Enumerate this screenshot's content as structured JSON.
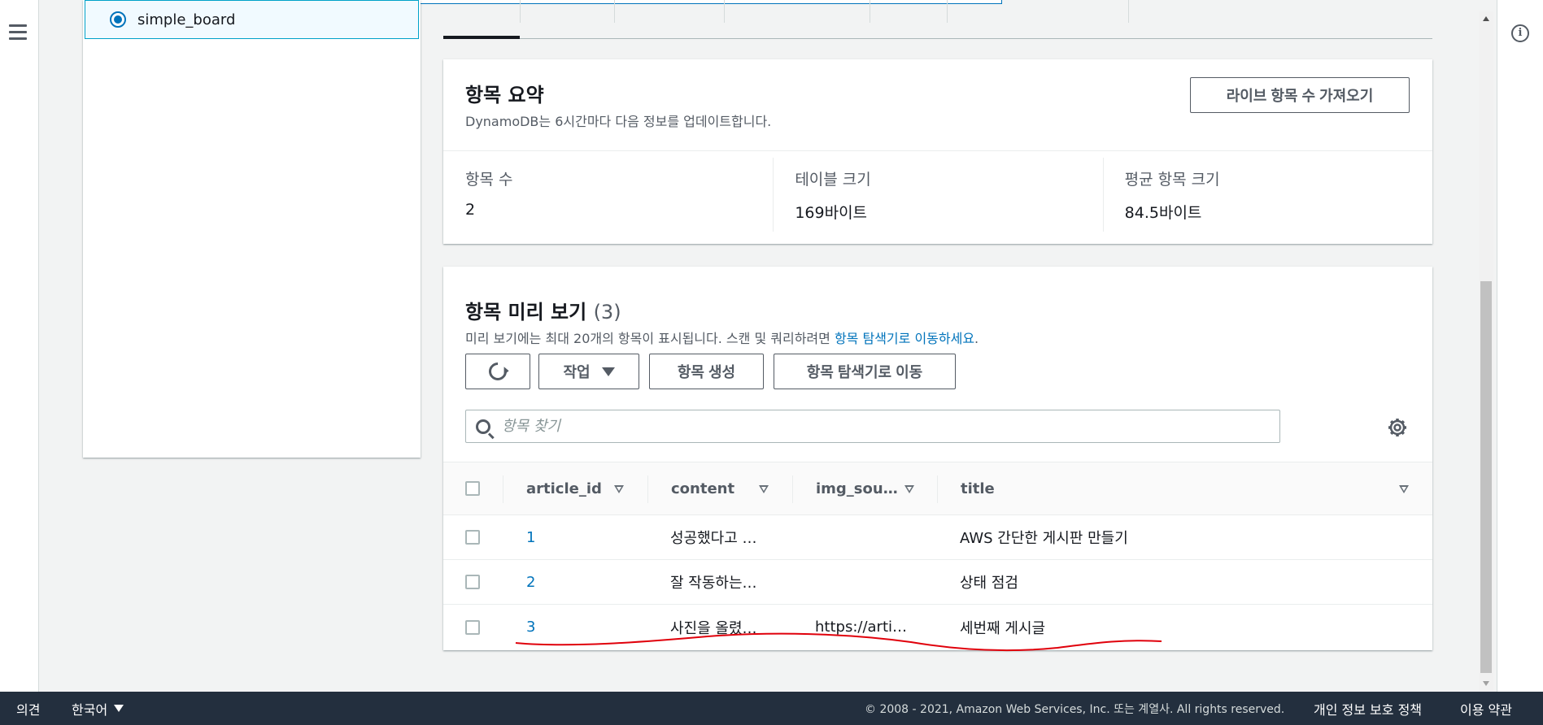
{
  "left_panel": {
    "selected_table": "simple_board"
  },
  "summary": {
    "title": "항목 요약",
    "description": "DynamoDB는 6시간마다 다음 정보를 업데이트합니다.",
    "live_count_button": "라이브 항목 수 가져오기",
    "stats": [
      {
        "label": "항목 수",
        "value": "2"
      },
      {
        "label": "테이블 크기",
        "value": "169바이트"
      },
      {
        "label": "평균 항목 크기",
        "value": "84.5바이트"
      }
    ]
  },
  "preview": {
    "title": "항목 미리 보기",
    "count": "(3)",
    "description_prefix": "미리 보기에는 최대 20개의 항목이 표시됩니다. 스캔 및 쿼리하려면",
    "description_link": "항목 탐색기로 이동하세요",
    "description_suffix": ".",
    "actions_label": "작업",
    "create_item_label": "항목 생성",
    "explore_label": "항목 탐색기로 이동",
    "search_placeholder": "항목 찾기",
    "columns": [
      "article_id",
      "content",
      "img_sou…",
      "title"
    ],
    "rows": [
      {
        "article_id": "1",
        "content": "성공했다고 …",
        "img_source": "",
        "title": "AWS 간단한 게시판 만들기"
      },
      {
        "article_id": "2",
        "content": "잘 작동하는…",
        "img_source": "",
        "title": "상태 점검"
      },
      {
        "article_id": "3",
        "content": "사진을 올렸…",
        "img_source": "https://arti…",
        "title": "세번째 게시글"
      }
    ]
  },
  "footer": {
    "feedback": "의견",
    "language": "한국어",
    "copyright": "© 2008 - 2021, Amazon Web Services, Inc. 또는 계열사. All rights reserved.",
    "privacy": "개인 정보 보호 정책",
    "terms": "이용 약관"
  },
  "colors": {
    "link": "#0073bb",
    "footer_bg": "#232f3e",
    "annotation": "#e0000b"
  }
}
